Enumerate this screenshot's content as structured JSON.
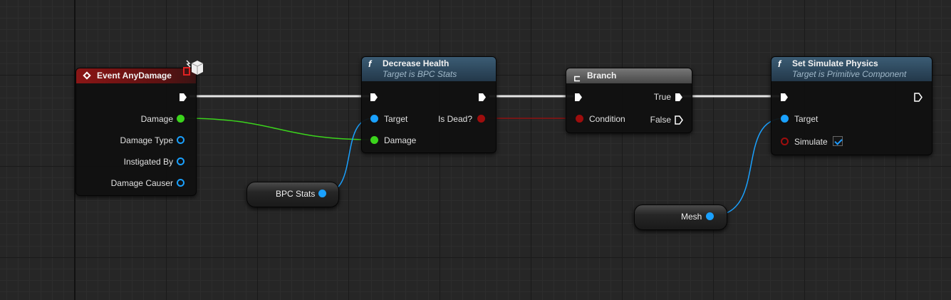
{
  "nodes": {
    "event": {
      "title": "Event AnyDamage",
      "pins": [
        "Damage",
        "Damage Type",
        "Instigated By",
        "Damage Causer"
      ]
    },
    "decrease": {
      "title": "Decrease Health",
      "subtitle": "Target is BPC Stats",
      "glyph": "f",
      "in_pins": [
        "Target",
        "Damage"
      ],
      "out_pin": "Is Dead?"
    },
    "branch": {
      "title": "Branch",
      "glyph": "⊏",
      "in_pin": "Condition",
      "out_true": "True",
      "out_false": "False"
    },
    "setsim": {
      "title": "Set Simulate Physics",
      "subtitle": "Target is Primitive Component",
      "glyph": "f",
      "in_pins": [
        "Target",
        "Simulate"
      ],
      "simulate_checked": true
    },
    "bpc_var": {
      "label": "BPC Stats"
    },
    "mesh_var": {
      "label": "Mesh"
    }
  },
  "colors": {
    "exec": "#ffffff",
    "object": "#1aa1ff",
    "float": "#3bd41c",
    "bool": "#9e0d0d",
    "event_header": "#8a1616",
    "func_header": "#3b5c74",
    "branch_header": "#777777"
  },
  "icons": [
    "event-diamond-icon",
    "function-icon",
    "branch-icon",
    "replication-cube-icon",
    "checkbox-check-icon"
  ]
}
